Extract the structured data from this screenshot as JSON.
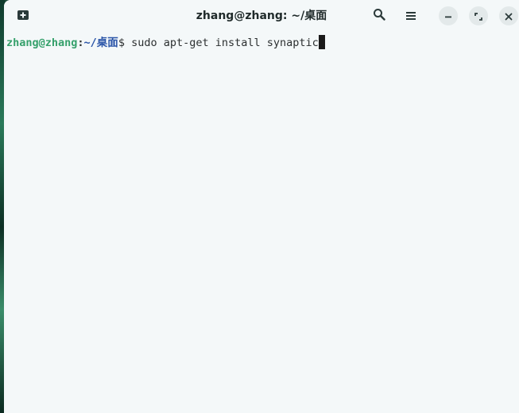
{
  "window": {
    "title": "zhang@zhang: ~/桌面"
  },
  "titlebar": {
    "icons": [
      "new-tab-icon",
      "search-icon",
      "hamburger-menu-icon",
      "minimize-icon",
      "maximize-icon",
      "close-icon"
    ]
  },
  "terminal": {
    "prompt_user_host": "zhang@zhang",
    "prompt_colon": ":",
    "prompt_path": "~/桌面",
    "prompt_sign": "$",
    "command": " sudo apt-get install synaptic"
  },
  "colors": {
    "background": "#f4f8f9",
    "prompt_user": "#35a06b",
    "prompt_path": "#2a55a8",
    "text": "#2b2f30"
  }
}
